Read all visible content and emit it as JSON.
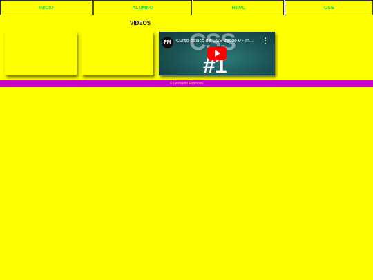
{
  "nav": {
    "items": [
      {
        "label": "INICIO"
      },
      {
        "label": "ALUMNO"
      },
      {
        "label": "HTML"
      },
      {
        "label": "CSS"
      }
    ]
  },
  "main": {
    "section_title": "VIDEOS",
    "player": {
      "channel_logo": "FM",
      "title": "Curso básico de CSS desde 0 - In...",
      "thumbnail_big_text": "CSS",
      "thumbnail_episode": "#1",
      "menu_icon": "more-vert-icon",
      "play_icon": "play-icon"
    }
  },
  "footer": {
    "text": "© Leonardo Espinosa"
  },
  "colors": {
    "background": "#ffff00",
    "nav_text": "#33d833",
    "footer_bg": "#cc00cc",
    "play_button": "#ff0000"
  }
}
